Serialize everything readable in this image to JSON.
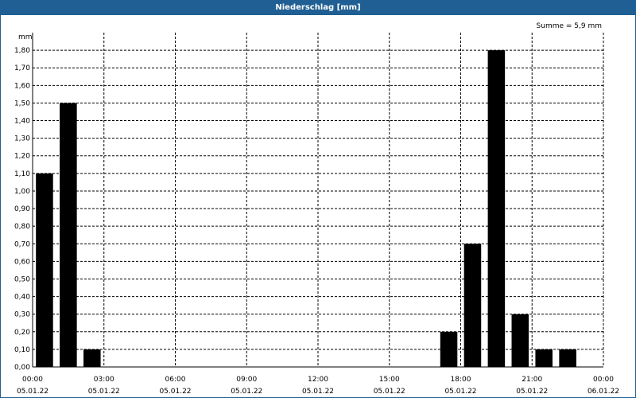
{
  "window": {
    "title": "Niederschlag [mm]"
  },
  "summary": {
    "text": "Summe = 5,9 mm"
  },
  "chart_data": {
    "type": "bar",
    "title": "Niederschlag [mm]",
    "ylabel": "mm",
    "xlabel": "",
    "ylim": [
      0,
      1.9
    ],
    "xlim_hours": [
      0,
      24
    ],
    "grid": true,
    "bar_color": "#000000",
    "y_ticks": [
      "0,00",
      "0,10",
      "0,20",
      "0,30",
      "0,40",
      "0,50",
      "0,60",
      "0,70",
      "0,80",
      "0,90",
      "1,00",
      "1,10",
      "1,20",
      "1,30",
      "1,40",
      "1,50",
      "1,60",
      "1,70",
      "1,80"
    ],
    "x_ticks": [
      {
        "time": "00:00",
        "date": "05.01.22"
      },
      {
        "time": "03:00",
        "date": "05.01.22"
      },
      {
        "time": "06:00",
        "date": "05.01.22"
      },
      {
        "time": "09:00",
        "date": "05.01.22"
      },
      {
        "time": "12:00",
        "date": "05.01.22"
      },
      {
        "time": "15:00",
        "date": "05.01.22"
      },
      {
        "time": "18:00",
        "date": "05.01.22"
      },
      {
        "time": "21:00",
        "date": "05.01.22"
      },
      {
        "time": "00:00",
        "date": "06.01.22"
      }
    ],
    "series": [
      {
        "x": [
          "00:30",
          "01:30",
          "02:30",
          "17:30",
          "18:30",
          "19:30",
          "20:30",
          "21:30",
          "22:30"
        ],
        "values": [
          1.1,
          1.5,
          0.1,
          0.2,
          0.7,
          1.8,
          0.3,
          0.1,
          0.1
        ]
      }
    ]
  }
}
